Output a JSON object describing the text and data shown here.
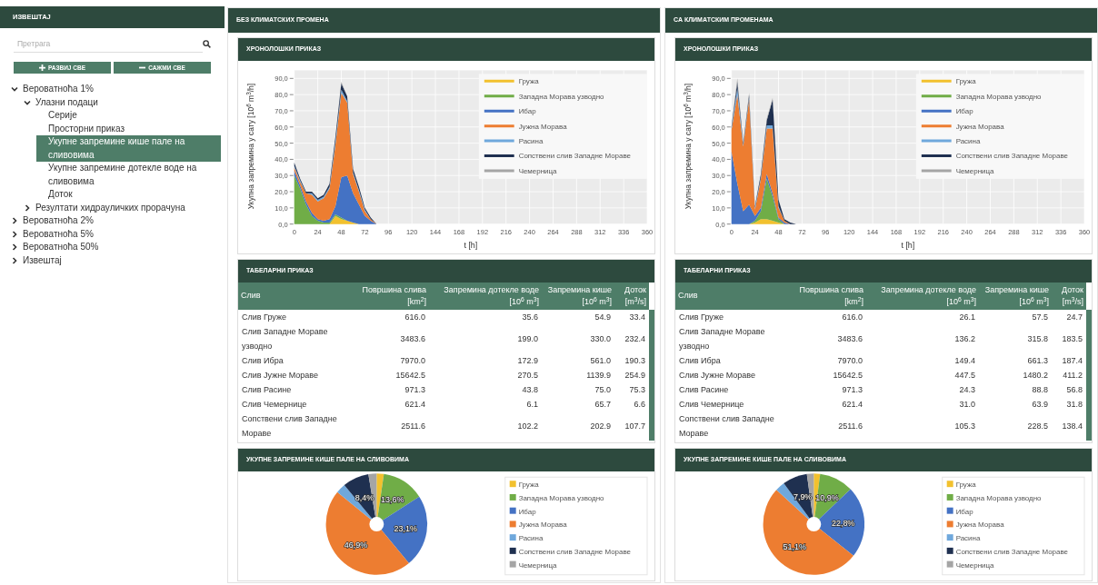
{
  "sidebar": {
    "title": "ИЗВЕШТАЈ",
    "search": {
      "placeholder": "Претрага"
    },
    "buttons": [
      {
        "kind": "expand",
        "label": "РАЗВИЈ СВЕ"
      },
      {
        "kind": "collapse",
        "label": "САЖМИ СВЕ"
      }
    ],
    "tree": [
      {
        "label": "Вероватноћа 1%",
        "expanded": true,
        "selected": false,
        "children": [
          {
            "label": "Улазни подаци",
            "expanded": true,
            "selected": false,
            "children": [
              {
                "label": "Серије",
                "selected": false
              },
              {
                "label": "Просторни приказ",
                "selected": false
              },
              {
                "label": "Укупне запремине кише пале на сливовима",
                "selected": true
              },
              {
                "label": "Укупне запремине дотекле воде на сливовима",
                "selected": false
              },
              {
                "label": "Доток",
                "selected": false
              }
            ]
          },
          {
            "label": "Резултати хидрауличких прорачуна",
            "expanded": false,
            "selected": false
          }
        ]
      },
      {
        "label": "Вероватноћа 2%",
        "expanded": false,
        "selected": false
      },
      {
        "label": "Вероватноћа 5%",
        "expanded": false,
        "selected": false
      },
      {
        "label": "Вероватноћа 50%",
        "expanded": false,
        "selected": false
      },
      {
        "label": "Извештај",
        "expanded": false,
        "selected": false
      }
    ]
  },
  "columns": [
    {
      "title": "БЕЗ КЛИМАТСКИХ ПРОМЕНА",
      "timeline": {
        "title": "ХРОНОЛОШКИ ПРИКАЗ",
        "chart_data": {
          "type": "area",
          "stacked": true,
          "xlabel": "t [h]",
          "ylabel": "Укупна запремина у сату [10$^{6}$ m$^{3}$/h]",
          "x": [
            0,
            6,
            12,
            18,
            24,
            30,
            36,
            42,
            48,
            54,
            60,
            66,
            72,
            78,
            84
          ],
          "series": [
            {
              "name": "Гружа",
              "color": "#f2c12e",
              "values": [
                0,
                0,
                0,
                0,
                0,
                0,
                0,
                5,
                3,
                2,
                1,
                0,
                0,
                0,
                0
              ]
            },
            {
              "name": "Западна Морава узводно",
              "color": "#70ad47",
              "values": [
                30,
                22,
                12,
                5,
                2,
                1,
                1,
                1,
                1,
                0,
                0,
                0,
                0,
                0,
                0
              ]
            },
            {
              "name": "Ибар",
              "color": "#4472c4",
              "values": [
                3,
                2,
                2,
                2,
                1,
                1,
                2,
                5,
                25,
                28,
                18,
                12,
                5,
                2,
                0
              ]
            },
            {
              "name": "Јужна Морава",
              "color": "#ed7d31",
              "values": [
                2,
                2,
                5,
                11,
                11,
                14,
                19,
                38,
                52,
                45,
                12,
                8,
                3,
                1,
                0
              ]
            },
            {
              "name": "Расина",
              "color": "#6fa8dc",
              "values": [
                1,
                1,
                0,
                1,
                1,
                1,
                1,
                2,
                2,
                1,
                1,
                1,
                1,
                0,
                0
              ]
            },
            {
              "name": "Сопствени слив Западне Мораве",
              "color": "#1f3050",
              "values": [
                2,
                1,
                1,
                1,
                1,
                1,
                2,
                3,
                4,
                3,
                2,
                2,
                1,
                1,
                0
              ]
            },
            {
              "name": "Чемерница",
              "color": "#a5a5a5",
              "values": [
                0,
                0,
                0,
                0,
                0,
                0,
                0,
                0,
                1,
                0,
                0,
                0,
                0,
                0,
                0
              ]
            }
          ],
          "xlim": [
            0,
            360
          ],
          "ylim": [
            0,
            95
          ],
          "grid": true,
          "legend": true,
          "xticks": [
            0,
            24,
            48,
            72,
            96,
            120,
            144,
            168,
            192,
            216,
            240,
            264,
            288,
            312,
            336,
            360
          ],
          "yticks": [
            {
              "value": 0,
              "label": "0,0"
            },
            {
              "value": 10,
              "label": "10,0"
            },
            {
              "value": 20,
              "label": "20,0"
            },
            {
              "value": 30,
              "label": "30,0"
            },
            {
              "value": 40,
              "label": "40,0"
            },
            {
              "value": 50,
              "label": "50,0"
            },
            {
              "value": 60,
              "label": "60,0"
            },
            {
              "value": 70,
              "label": "70,0"
            },
            {
              "value": 80,
              "label": "80,0"
            },
            {
              "value": 90,
              "label": "90,0"
            }
          ]
        }
      },
      "table": {
        "title": "ТАБЕЛАРНИ ПРИКАЗ",
        "columns": [
          {
            "label": "Слив"
          },
          {
            "label": "Површина слива",
            "unit": "[km$^{2}$]"
          },
          {
            "label": "Запремина дотекле воде",
            "unit": "[10$^{6}$ m$^{3}$]"
          },
          {
            "label": "Запремина кише",
            "unit": "[10$^{6}$ m$^{3}$]"
          },
          {
            "label": "Доток",
            "unit": "[m$^{3}$/s]"
          }
        ],
        "rows": [
          [
            "Слив Груже",
            "616.0",
            "35.6",
            "54.9",
            "33.4"
          ],
          [
            "Слив Западне Мораве узводно",
            "3483.6",
            "199.0",
            "330.0",
            "232.4"
          ],
          [
            "Слив Ибра",
            "7970.0",
            "172.9",
            "561.0",
            "190.3"
          ],
          [
            "Слив Јужне Мораве",
            "15642.5",
            "270.5",
            "1139.9",
            "254.9"
          ],
          [
            "Слив Расине",
            "971.3",
            "43.8",
            "75.0",
            "75.3"
          ],
          [
            "Слив Чемернице",
            "621.4",
            "6.1",
            "65.7",
            "6.6"
          ],
          [
            "Сопствени слив Западне Мораве",
            "2511.6",
            "102.2",
            "202.9",
            "107.7"
          ]
        ]
      },
      "pie": {
        "title": "УКУПНЕ ЗАПРЕМИНЕ КИШЕ ПАЛЕ НА СЛИВОВИМА",
        "chart_data": {
          "type": "pie",
          "categories": [
            "Гружа",
            "Западна Морава узводно",
            "Ибар",
            "Јужна Морава",
            "Расина",
            "Сопствени слив Западне Мораве",
            "Чемерница"
          ],
          "colors": [
            "#f2c12e",
            "#70ad47",
            "#4472c4",
            "#ed7d31",
            "#6fa8dc",
            "#1f3050",
            "#a5a5a5"
          ],
          "values": [
            2.3,
            13.6,
            23.1,
            46.9,
            3.1,
            8.4,
            2.6
          ],
          "legend": true,
          "value_labels": [
            null,
            "13,6%",
            "23,1%",
            "46,9%",
            null,
            "8,4%",
            null
          ]
        }
      }
    },
    {
      "title": "СА КЛИМАТСКИМ ПРОМЕНАМА",
      "timeline": {
        "title": "ХРОНОЛОШКИ ПРИКАЗ",
        "chart_data": {
          "type": "area",
          "stacked": true,
          "xlabel": "t [h]",
          "ylabel": "Укупна запремина у сату [10$^{6}$ m$^{3}$/h]",
          "x": [
            0,
            6,
            12,
            18,
            24,
            30,
            36,
            42,
            48,
            54,
            60,
            66
          ],
          "series": [
            {
              "name": "Гружа",
              "color": "#f2c12e",
              "values": [
                0,
                0,
                0,
                0,
                1,
                3,
                3,
                2,
                1,
                0,
                0,
                0
              ]
            },
            {
              "name": "Западна Морава узводно",
              "color": "#70ad47",
              "values": [
                0,
                0,
                0,
                0,
                1,
                5,
                25,
                15,
                2,
                0,
                0,
                0
              ]
            },
            {
              "name": "Ибар",
              "color": "#4472c4",
              "values": [
                45,
                25,
                8,
                12,
                3,
                2,
                3,
                2,
                1,
                1,
                0,
                0
              ]
            },
            {
              "name": "Јужна Морава",
              "color": "#ed7d31",
              "values": [
                13,
                55,
                40,
                65,
                4,
                18,
                28,
                40,
                6,
                1,
                0,
                0
              ]
            },
            {
              "name": "Расина",
              "color": "#6fa8dc",
              "values": [
                1,
                4,
                1,
                1,
                1,
                1,
                2,
                2,
                1,
                0,
                0,
                0
              ]
            },
            {
              "name": "Сопствени слив Западне Мораве",
              "color": "#1f3050",
              "values": [
                1,
                4,
                1,
                2,
                1,
                2,
                3,
                16,
                4,
                1,
                1,
                0
              ]
            },
            {
              "name": "Чемерница",
              "color": "#a5a5a5",
              "values": [
                0,
                2,
                0,
                1,
                0,
                0,
                1,
                1,
                0,
                0,
                0,
                0
              ]
            }
          ],
          "xlim": [
            0,
            360
          ],
          "ylim": [
            0,
            95
          ],
          "grid": true,
          "legend": true,
          "xticks": [
            0,
            24,
            48,
            72,
            96,
            120,
            144,
            168,
            192,
            216,
            240,
            264,
            288,
            312,
            336,
            360
          ],
          "yticks": [
            {
              "value": 0,
              "label": "0,0"
            },
            {
              "value": 10,
              "label": "10,0"
            },
            {
              "value": 20,
              "label": "20,0"
            },
            {
              "value": 30,
              "label": "30,0"
            },
            {
              "value": 40,
              "label": "40,0"
            },
            {
              "value": 50,
              "label": "50,0"
            },
            {
              "value": 60,
              "label": "60,0"
            },
            {
              "value": 70,
              "label": "70,0"
            },
            {
              "value": 80,
              "label": "80,0"
            },
            {
              "value": 90,
              "label": "90,0"
            }
          ]
        }
      },
      "table": {
        "title": "ТАБЕЛАРНИ ПРИКАЗ",
        "columns": [
          {
            "label": "Слив"
          },
          {
            "label": "Површина слива",
            "unit": "[km$^{2}$]"
          },
          {
            "label": "Запремина дотекле воде",
            "unit": "[10$^{6}$ m$^{3}$]"
          },
          {
            "label": "Запремина кише",
            "unit": "[10$^{6}$ m$^{3}$]"
          },
          {
            "label": "Доток",
            "unit": "[m$^{3}$/s]"
          }
        ],
        "rows": [
          [
            "Слив Груже",
            "616.0",
            "26.1",
            "57.5",
            "24.7"
          ],
          [
            "Слив Западне Мораве узводно",
            "3483.6",
            "136.2",
            "315.8",
            "183.5"
          ],
          [
            "Слив Ибра",
            "7970.0",
            "149.4",
            "661.3",
            "187.4"
          ],
          [
            "Слив Јужне Мораве",
            "15642.5",
            "447.5",
            "1480.2",
            "411.2"
          ],
          [
            "Слив Расине",
            "971.3",
            "24.3",
            "88.8",
            "56.8"
          ],
          [
            "Слив Чемернице",
            "621.4",
            "31.0",
            "63.9",
            "31.8"
          ],
          [
            "Сопствени слив Западне Мораве",
            "2511.6",
            "105.3",
            "228.5",
            "138.4"
          ]
        ]
      },
      "pie": {
        "title": "УКУПНЕ ЗАПРЕМИНЕ КИШЕ ПАЛЕ НА СЛИВОВИМА",
        "chart_data": {
          "type": "pie",
          "categories": [
            "Гружа",
            "Западна Морава узводно",
            "Ибар",
            "Јужна Морава",
            "Расина",
            "Сопствени слив Западне Мораве",
            "Чемерница"
          ],
          "colors": [
            "#f2c12e",
            "#70ad47",
            "#4472c4",
            "#ed7d31",
            "#6fa8dc",
            "#1f3050",
            "#a5a5a5"
          ],
          "values": [
            2.0,
            10.9,
            22.8,
            51.1,
            3.1,
            7.9,
            2.2
          ],
          "legend": true,
          "value_labels": [
            null,
            "10,9%",
            "22,8%",
            "51,1%",
            null,
            "7,9%",
            null
          ]
        }
      }
    }
  ]
}
